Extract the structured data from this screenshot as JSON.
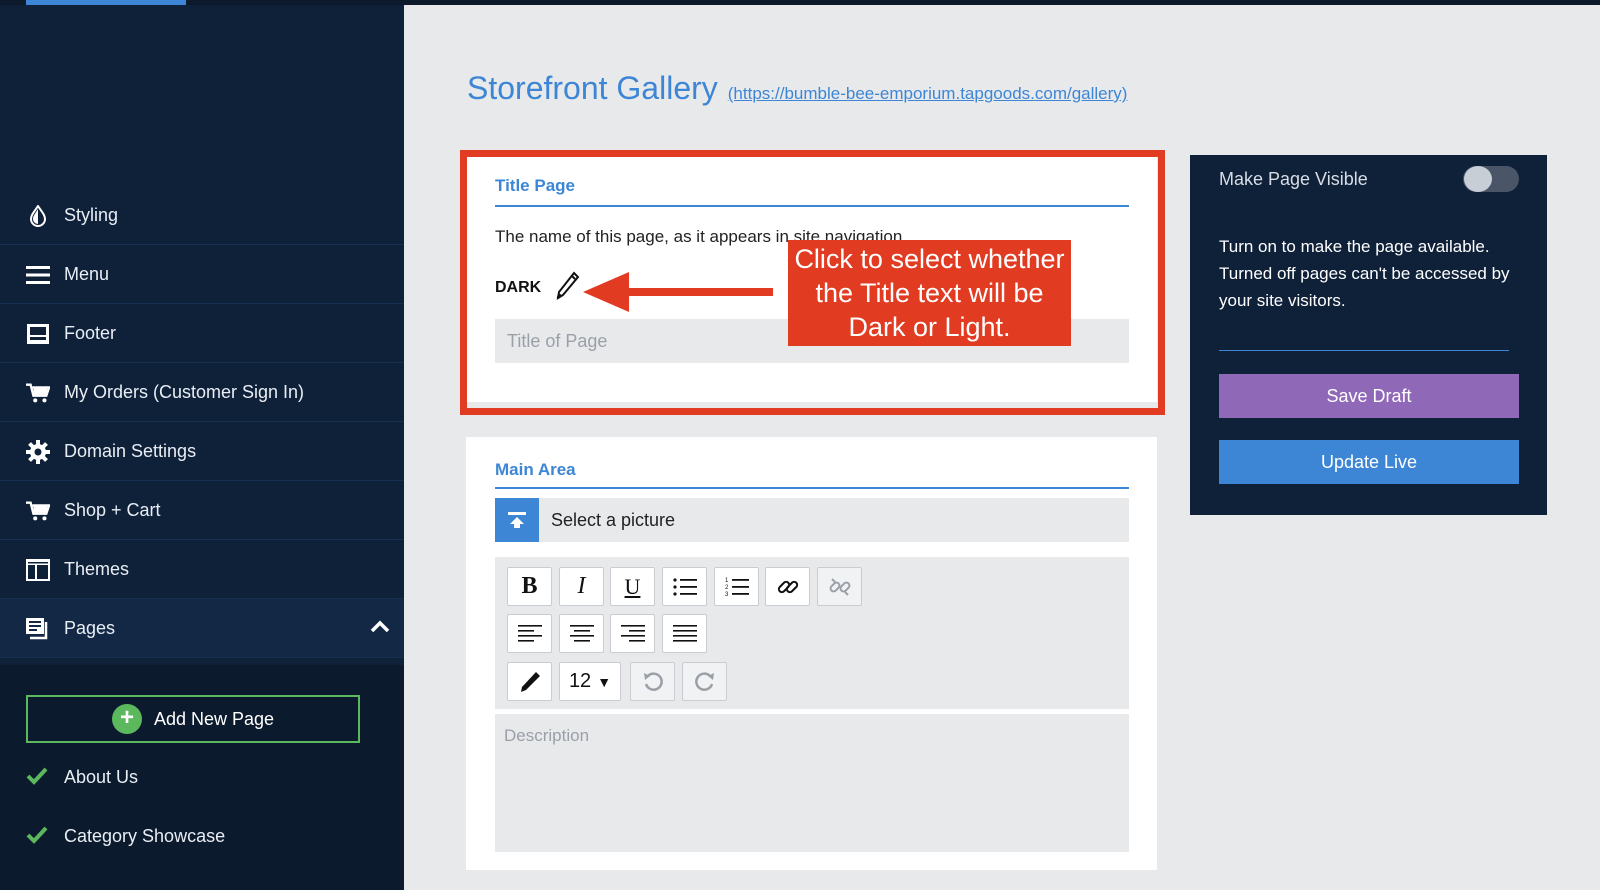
{
  "sidebar": {
    "items": [
      {
        "label": "Styling",
        "icon": "droplet-icon"
      },
      {
        "label": "Menu",
        "icon": "hamburger-icon"
      },
      {
        "label": "Footer",
        "icon": "footer-layout-icon"
      },
      {
        "label": "My Orders (Customer Sign In)",
        "icon": "cart-icon"
      },
      {
        "label": "Domain Settings",
        "icon": "gear-icon"
      },
      {
        "label": "Shop + Cart",
        "icon": "cart-icon"
      },
      {
        "label": "Themes",
        "icon": "layout-icon"
      },
      {
        "label": "Pages",
        "icon": "pages-icon"
      }
    ],
    "add_page_label": "Add New Page",
    "sub_items": [
      "About Us",
      "Category Showcase"
    ]
  },
  "header": {
    "title": "Storefront Gallery",
    "link": "(https://bumble-bee-emporium.tapgoods.com/gallery)"
  },
  "title_section": {
    "heading": "Title Page",
    "description": "The name of this page, as it appears in site navigation.",
    "color_mode": "DARK",
    "input_placeholder": "Title of Page"
  },
  "callout": {
    "text": "Click to select whether the Title text will be Dark or Light."
  },
  "main_area": {
    "heading": "Main Area",
    "picture_label": "Select a picture",
    "font_size": "12",
    "description_placeholder": "Description"
  },
  "side_panel": {
    "visible_label": "Make Page Visible",
    "visible_on": false,
    "help_text": "Turn on to make the page available. Turned off pages can't be accessed by your site visitors.",
    "save_draft_label": "Save Draft",
    "update_live_label": "Update Live"
  },
  "colors": {
    "accent": "#3d86d6",
    "sidebar_bg": "#0f2039",
    "annotation_red": "#e13b22",
    "draft_purple": "#9068b8",
    "success_green": "#5cb85c"
  }
}
